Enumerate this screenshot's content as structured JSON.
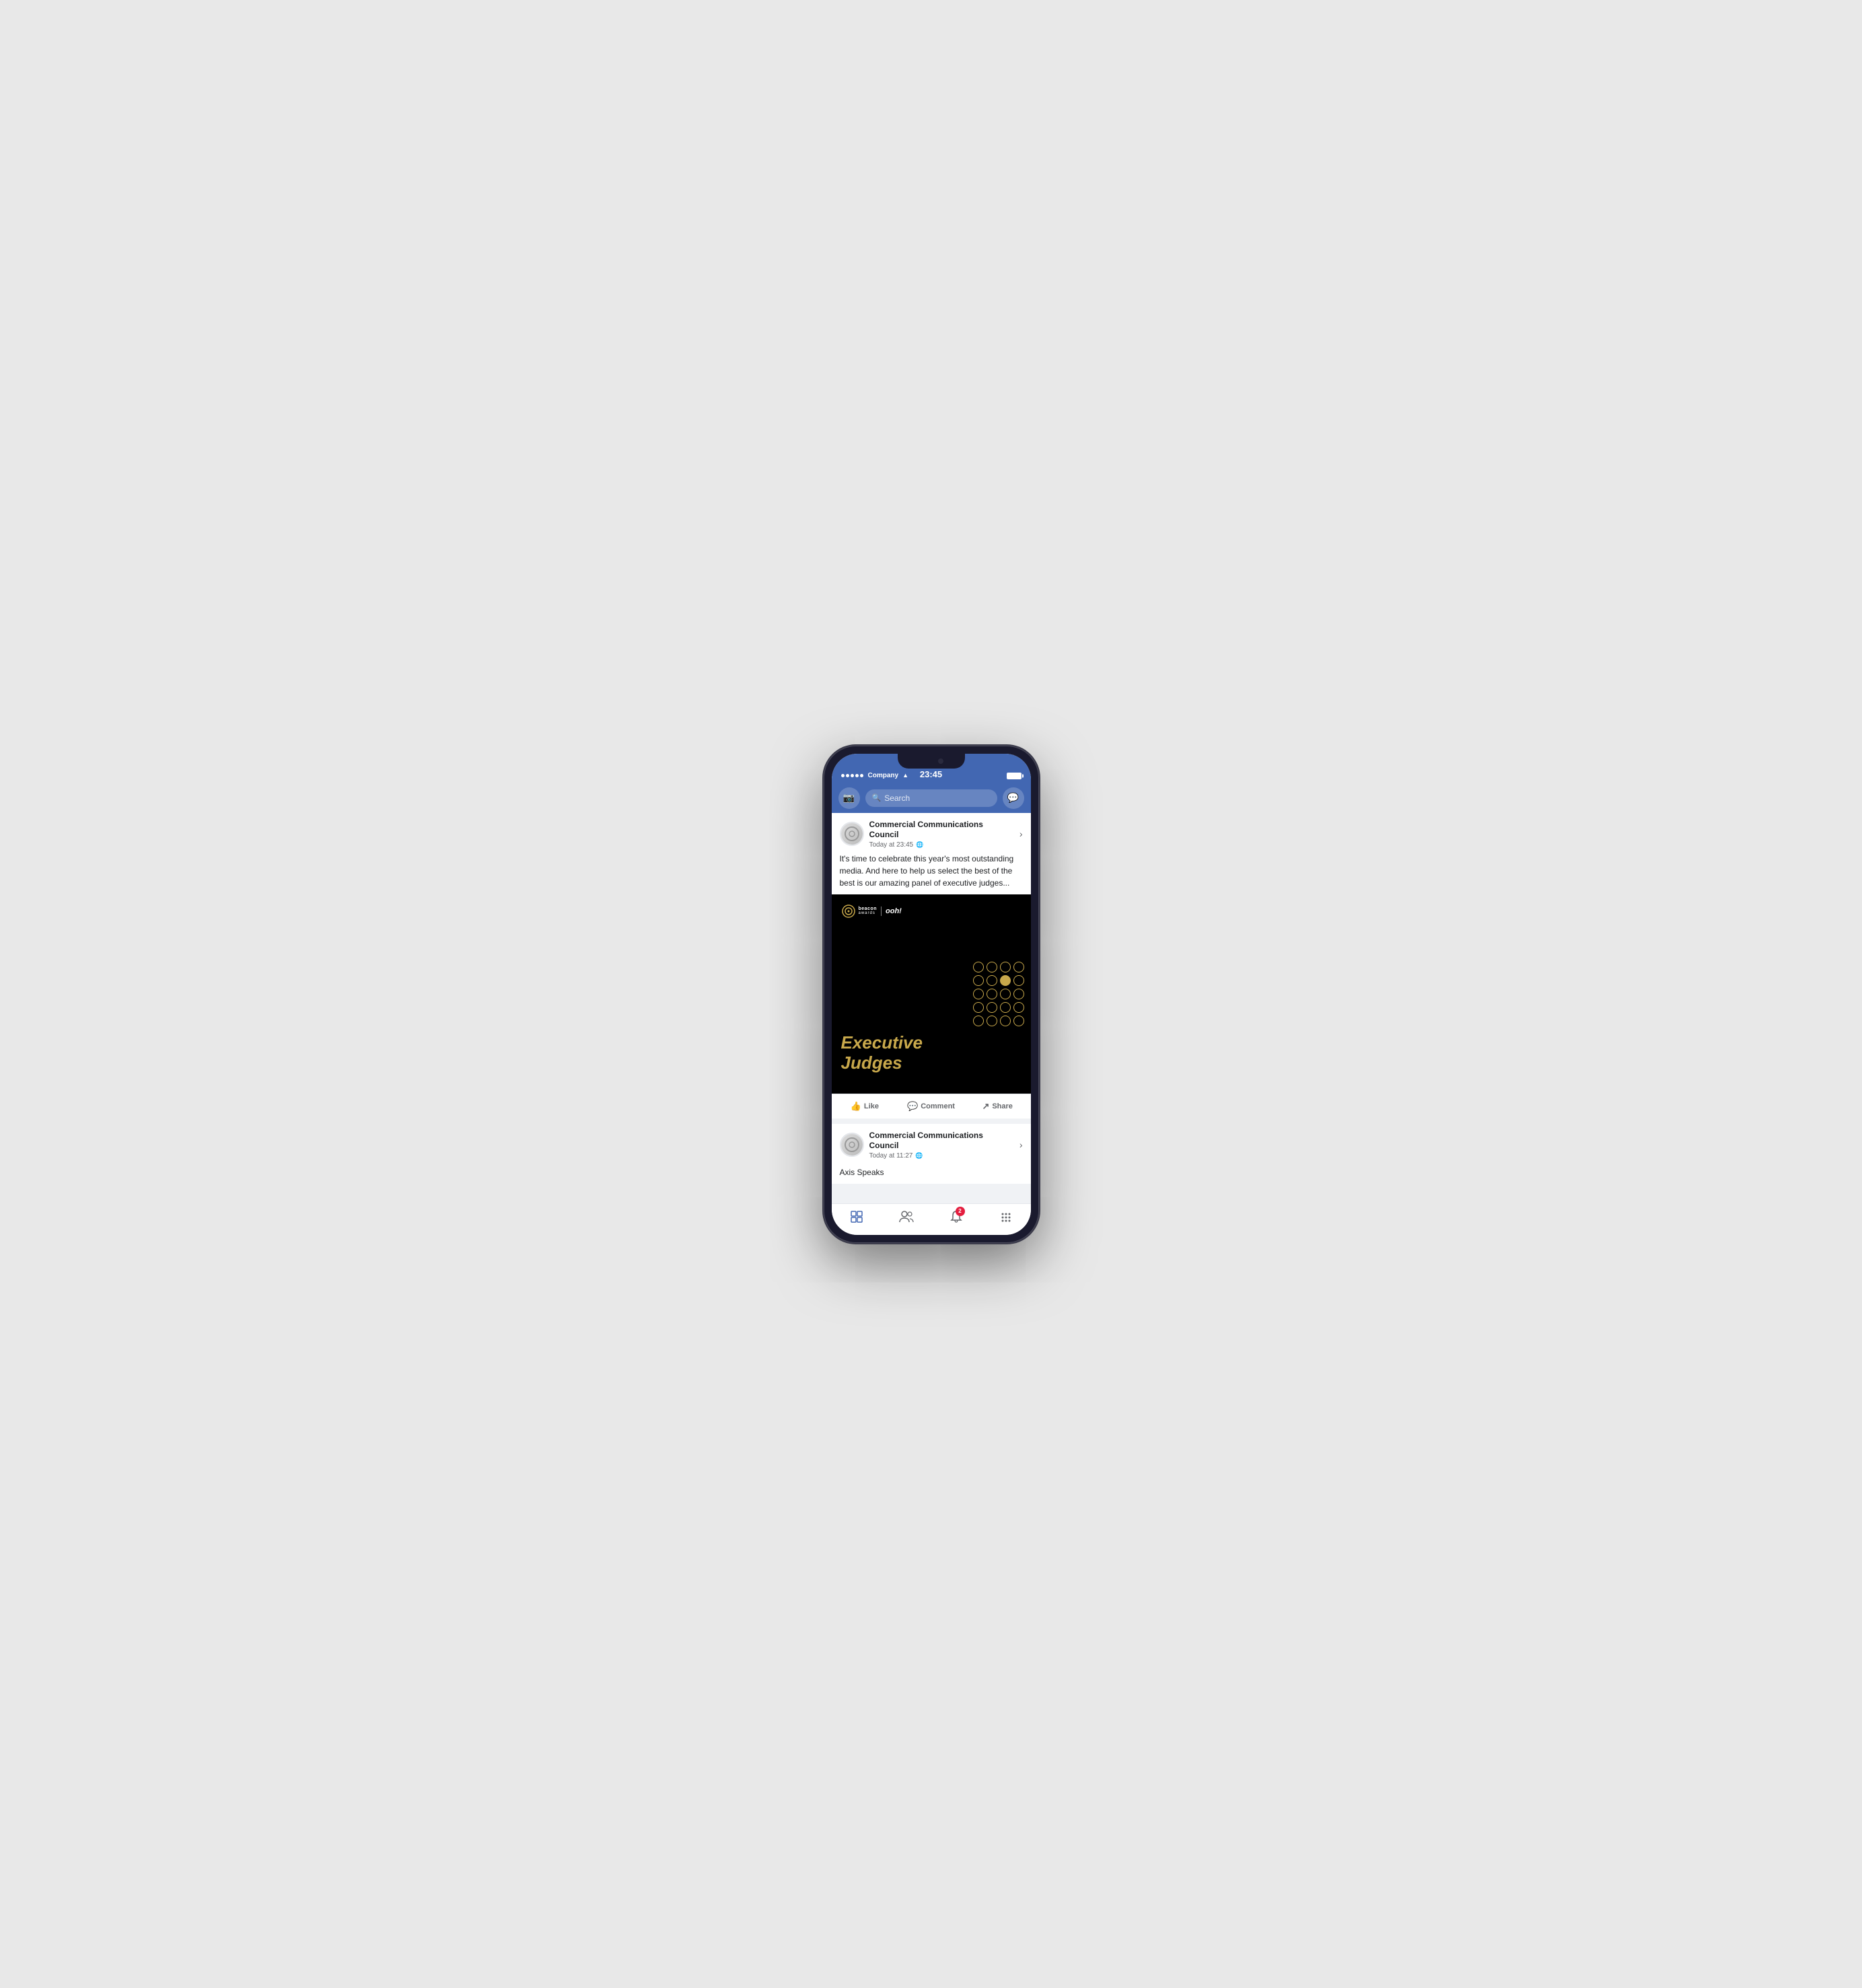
{
  "background": "#e8e8e8",
  "phone": {
    "status_bar": {
      "signal": "●●●●●",
      "carrier": "Company",
      "wifi": "⚲",
      "time": "23:45",
      "battery_full": true
    },
    "navbar": {
      "search_placeholder": "Search"
    },
    "post1": {
      "page_name": "Commercial Communications Council",
      "time": "Today at 23:45",
      "globe_icon": "🌐",
      "body_text": "It's time to celebrate this year's most outstanding media. And here to help us select the best of the best is our amazing panel of executive judges...",
      "image_alt": "Executive Judges - Beacon Awards",
      "image_title_line1": "Executive",
      "image_title_line2": "Judges",
      "actions": {
        "like": "Like",
        "comment": "Comment",
        "share": "Share"
      }
    },
    "post2": {
      "page_name": "Commercial Communications Council",
      "time": "Today at 11:27",
      "globe_icon": "🌐",
      "body_text": "Axis Speaks"
    },
    "tabbar": {
      "home_icon": "⊡",
      "friends_icon": "👥",
      "notifications_icon": "🔔",
      "badge_count": "2",
      "menu_icon": "⋮⋮⋮"
    }
  }
}
